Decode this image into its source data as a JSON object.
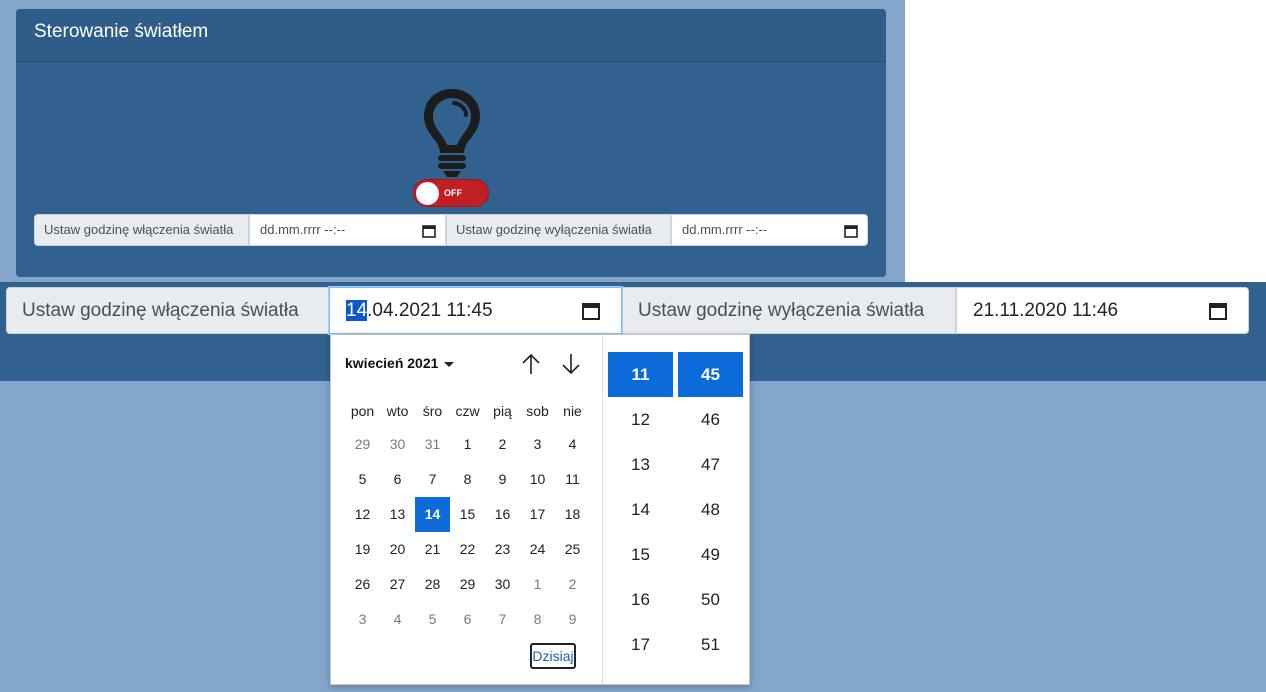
{
  "card": {
    "title": "Sterowanie światłem",
    "toggle_state": "OFF"
  },
  "small_row": {
    "on_label": "Ustaw godzinę włączenia światła",
    "on_placeholder": "dd.mm.rrrr --:--",
    "off_label": "Ustaw godzinę wyłączenia światła",
    "off_placeholder": "dd.mm.rrrr --:--"
  },
  "big_row": {
    "on_label": "Ustaw godzinę włączenia światła",
    "on_day": "14",
    "on_rest": ".04.2021 11:45",
    "off_label": "Ustaw godzinę wyłączenia światła",
    "off_value": "21.11.2020 11:46"
  },
  "picker": {
    "month": "kwiecień 2021",
    "weekdays": [
      "pon",
      "wto",
      "śro",
      "czw",
      "pią",
      "sob",
      "nie"
    ],
    "days": [
      {
        "d": "29",
        "out": true
      },
      {
        "d": "30",
        "out": true
      },
      {
        "d": "31",
        "out": true
      },
      {
        "d": "1"
      },
      {
        "d": "2"
      },
      {
        "d": "3"
      },
      {
        "d": "4"
      },
      {
        "d": "5"
      },
      {
        "d": "6"
      },
      {
        "d": "7"
      },
      {
        "d": "8"
      },
      {
        "d": "9"
      },
      {
        "d": "10"
      },
      {
        "d": "11"
      },
      {
        "d": "12"
      },
      {
        "d": "13"
      },
      {
        "d": "14",
        "selected": true
      },
      {
        "d": "15"
      },
      {
        "d": "16"
      },
      {
        "d": "17"
      },
      {
        "d": "18"
      },
      {
        "d": "19"
      },
      {
        "d": "20"
      },
      {
        "d": "21"
      },
      {
        "d": "22"
      },
      {
        "d": "23"
      },
      {
        "d": "24"
      },
      {
        "d": "25"
      },
      {
        "d": "26"
      },
      {
        "d": "27"
      },
      {
        "d": "28"
      },
      {
        "d": "29"
      },
      {
        "d": "30"
      },
      {
        "d": "1",
        "out": true
      },
      {
        "d": "2",
        "out": true
      },
      {
        "d": "3",
        "out": true
      },
      {
        "d": "4",
        "out": true
      },
      {
        "d": "5",
        "out": true
      },
      {
        "d": "6",
        "out": true
      },
      {
        "d": "7",
        "out": true
      },
      {
        "d": "8",
        "out": true
      },
      {
        "d": "9",
        "out": true
      }
    ],
    "today_label": "Dzisiaj",
    "hours": [
      "11",
      "12",
      "13",
      "14",
      "15",
      "16",
      "17"
    ],
    "minutes": [
      "45",
      "46",
      "47",
      "48",
      "49",
      "50",
      "51"
    ],
    "selected_hour": "11",
    "selected_minute": "45"
  },
  "icons": {
    "bulb": "lightbulb-icon",
    "calendar": "calendar-icon",
    "up": "arrow-up-icon",
    "down": "arrow-down-icon"
  },
  "colors": {
    "panel": "#31618f",
    "background": "#82a5c9",
    "accent": "#0b6bd9",
    "toggle_off": "#c01f24"
  }
}
